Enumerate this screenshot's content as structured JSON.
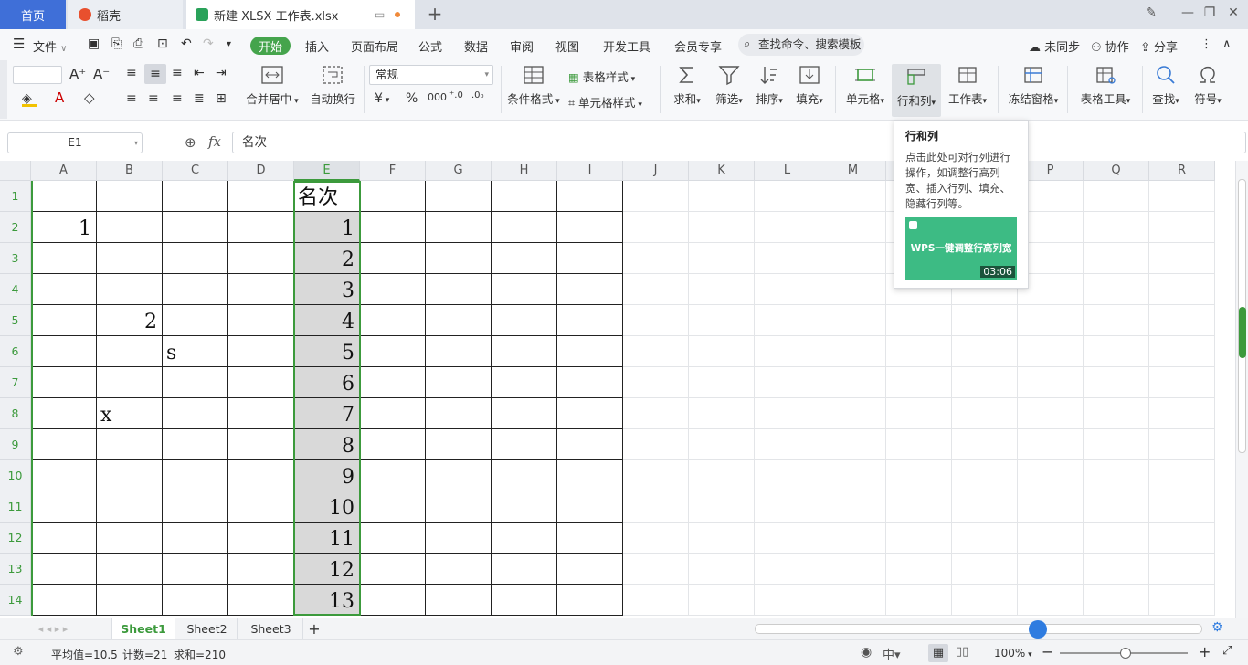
{
  "tabs": {
    "home": "首页",
    "daoke": "稻壳",
    "file": "新建 XLSX 工作表.xlsx",
    "add": "+"
  },
  "menu": {
    "file": "文件",
    "start": "开始",
    "items": [
      "插入",
      "页面布局",
      "公式",
      "数据",
      "审阅",
      "视图",
      "开发工具",
      "会员专享"
    ],
    "search": "查找命令、搜索模板",
    "sync": "未同步",
    "collab": "协作",
    "share": "分享"
  },
  "toolbar": {
    "merge": "合并居中",
    "wrap": "自动换行",
    "format_select": "常规",
    "cond_format": "条件格式",
    "table_style": "表格样式",
    "cell_style": "单元格样式",
    "sum": "求和",
    "filter": "筛选",
    "sort": "排序",
    "fill": "填充",
    "cell": "单元格",
    "rowcol": "行和列",
    "worksheet": "工作表",
    "freeze": "冻结窗格",
    "table_tools": "表格工具",
    "find": "查找",
    "symbol": "符号",
    "currency": "¥",
    "percent": "%"
  },
  "formula_bar": {
    "name_box": "E1",
    "fx": "fx",
    "content": "名次"
  },
  "columns": [
    "A",
    "B",
    "C",
    "D",
    "E",
    "F",
    "G",
    "H",
    "I",
    "J",
    "K",
    "L",
    "M",
    "N",
    "O",
    "P",
    "Q",
    "R"
  ],
  "rows": [
    "1",
    "2",
    "3",
    "4",
    "5",
    "6",
    "7",
    "8",
    "9",
    "10",
    "11",
    "12",
    "13",
    "14"
  ],
  "cells": {
    "A2": "1",
    "B5": "2",
    "C6": "s",
    "B8": "x",
    "E1": "名次",
    "E2": "1",
    "E3": "2",
    "E4": "3",
    "E5": "4",
    "E6": "5",
    "E7": "6",
    "E8": "7",
    "E9": "8",
    "E10": "9",
    "E11": "10",
    "E12": "11",
    "E13": "12",
    "E14": "13"
  },
  "tooltip": {
    "title": "行和列",
    "body": "点击此处可对行列进行操作，如调整行高列宽、插入行列、填充、隐藏行列等。",
    "video_title": "WPS一键调整行高列宽",
    "duration": "03:06"
  },
  "sheets": [
    "Sheet1",
    "Sheet2",
    "Sheet3"
  ],
  "active_sheet": "Sheet1",
  "status": {
    "average": "平均值=10.5",
    "count": "计数=21",
    "sum": "求和=210",
    "zoom": "100%"
  },
  "colors": {
    "accent_green": "#45a44c",
    "tab_blue": "#3f6fd8",
    "selection_border": "#3c9a3c"
  }
}
